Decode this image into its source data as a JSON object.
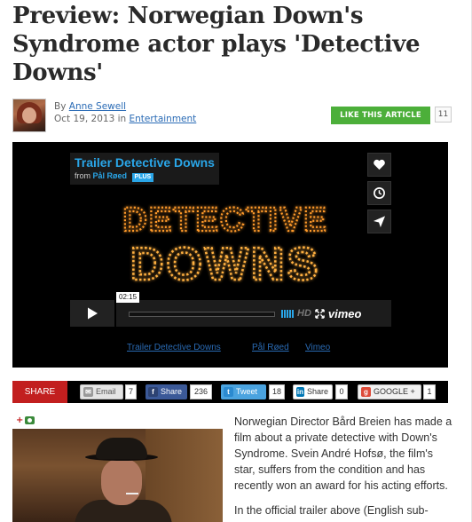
{
  "article": {
    "title": "Preview: Norwegian Down's Syndrome actor plays 'Detective Downs'",
    "by_prefix": "By",
    "author": "Anne Sewell",
    "date": "Oct 19, 2013",
    "in_word": "in",
    "category": "Entertainment",
    "like_label": "LIKE THIS ARTICLE",
    "like_count": "11",
    "paragraph1": "Norwegian Director Bård Breien has made a film about a private detective with Down's Syndrome. Svein André Hofsø, the film's star, suffers from the condition and has recently won an award for his acting efforts.",
    "paragraph2": "In the official trailer above (English sub-"
  },
  "video": {
    "title": "Trailer Detective Downs",
    "from_label": "from",
    "owner": "Pål Røed",
    "plus_badge": "PLUS",
    "marquee_line1": "DETECTIVE",
    "marquee_line2": "DOWNS",
    "timecode": "02:15",
    "hd_label": "HD",
    "brand": "vimeo",
    "links": {
      "video_link": "Trailer Detective Downs",
      "owner_link": "Pål Røed",
      "vimeo_link": "Vimeo"
    },
    "accent_color": "#2aa6e8"
  },
  "share": {
    "label": "SHARE",
    "email_label": "Email",
    "email_count": "7",
    "facebook_label": "Share",
    "facebook_count": "236",
    "twitter_label": "Tweet",
    "twitter_count": "18",
    "linkedin_label": "Share",
    "linkedin_count": "0",
    "google_label": "GOOGLE +",
    "google_count": "1",
    "bar_color": "#c21f1f"
  },
  "photo": {
    "add_symbol": "+"
  }
}
